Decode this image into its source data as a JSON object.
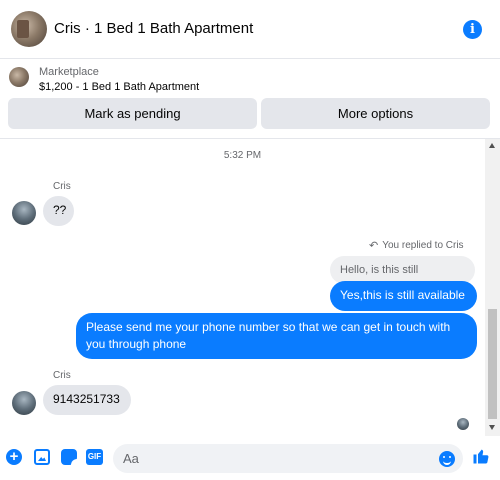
{
  "header": {
    "title": "Cris · 1 Bed 1 Bath Apartment",
    "info_icon": "i"
  },
  "marketplace": {
    "label": "Marketplace",
    "listing": "$1,200 - 1 Bed 1 Bath Apartment",
    "pending_button": "Mark as pending",
    "more_button": "More options"
  },
  "chat": {
    "timestamp": "5:32 PM",
    "messages": [
      {
        "sender": "Cris",
        "text": "??",
        "direction": "incoming"
      },
      {
        "replied_note": "You replied to Cris",
        "quoted": "Hello, is this still available?",
        "text": "Yes,this is still available",
        "direction": "outgoing"
      },
      {
        "text": "Please send me your phone  number so that we can get in touch with you through phone",
        "direction": "outgoing"
      },
      {
        "sender": "Cris",
        "text": "9143251733",
        "direction": "incoming"
      }
    ]
  },
  "composer": {
    "placeholder": "Aa",
    "gif_label": "GIF",
    "plus_label": "+"
  },
  "colors": {
    "accent": "#0a7cff",
    "bubble_incoming": "#e4e6eb",
    "secondary_text": "#65676b"
  },
  "icons": [
    "info-icon",
    "plus-icon",
    "photo-icon",
    "sticker-icon",
    "gif-icon",
    "emoji-icon",
    "like-icon",
    "reply-icon"
  ]
}
